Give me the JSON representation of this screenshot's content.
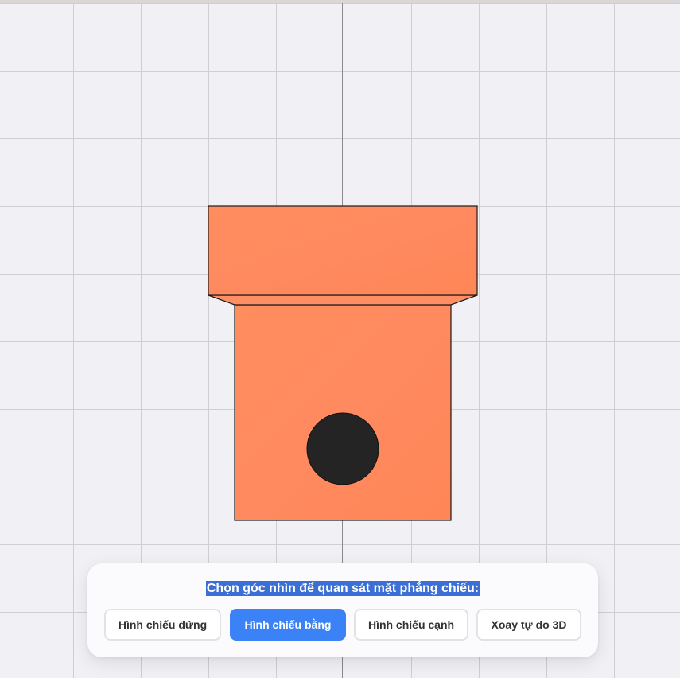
{
  "panel": {
    "title": "Chọn góc nhìn để quan sát mặt phẳng chiếu:",
    "buttons": [
      {
        "label": "Hình chiếu đứng",
        "active": false
      },
      {
        "label": "Hình chiếu bằng",
        "active": true
      },
      {
        "label": "Hình chiếu cạnh",
        "active": false
      },
      {
        "label": "Xoay tự do 3D",
        "active": false
      }
    ]
  },
  "colors": {
    "background": "#f1f1f5",
    "grid_line": "#cfcfd3",
    "axis_line": "#8a8a8e",
    "part_face": "#ff8a5c",
    "hole": "#242424",
    "accent": "#3b82f6",
    "title_highlight": "#3b6fd6"
  },
  "model": {
    "description_icon": "stepped-block-with-hole-icon"
  }
}
